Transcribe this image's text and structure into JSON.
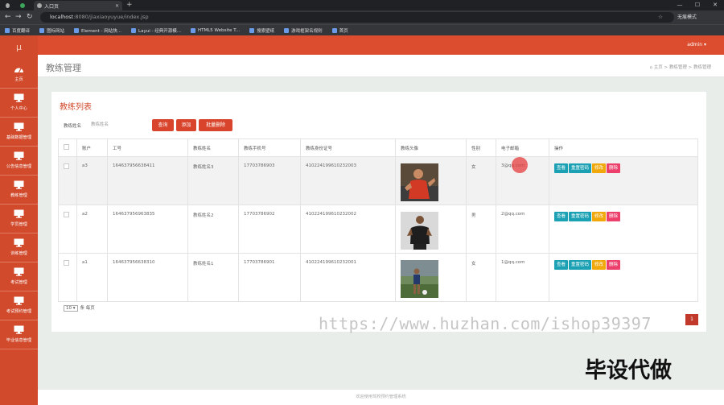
{
  "browser": {
    "tab_title": "入口页",
    "url_host": "localhost",
    "url_rest": ":8080/jiaxiaoyuyue/index.jsp",
    "profile": "无痕模式",
    "bookmarks": [
      "百度翻译",
      "图标网站",
      "Element - 网站快...",
      "Layui - 经典开源模...",
      "HTML5 Website T...",
      "搜索壁纸",
      "游戏框架名规则",
      "首页"
    ]
  },
  "app": {
    "logo": "μ",
    "admin": "admin ▾",
    "sidebar": [
      {
        "label": "主页"
      },
      {
        "label": "个人中心"
      },
      {
        "label": "基础数据管理"
      },
      {
        "label": "公告信息管理"
      },
      {
        "label": "教练管理"
      },
      {
        "label": "学员管理"
      },
      {
        "label": "训练管理"
      },
      {
        "label": "考试管理"
      },
      {
        "label": "考试预约管理"
      },
      {
        "label": "毕业信息管理"
      }
    ],
    "page_title": "教练管理",
    "breadcrumb": "⌂ 主页 > 教练管理 > 教练管理"
  },
  "panel": {
    "title": "教练列表",
    "search_label": "教练姓名",
    "search_placeholder": "教练姓名",
    "btn_query": "查询",
    "btn_add": "添加",
    "btn_batch_delete": "批量删除",
    "columns": [
      "",
      "账户",
      "工号",
      "教练姓名",
      "教练手机号",
      "教练身份证号",
      "教练头像",
      "性别",
      "电子邮箱",
      "操作"
    ],
    "rows": [
      {
        "account": "a3",
        "job_no": "164637956638411",
        "name": "教练姓名3",
        "phone": "17703786903",
        "id_card": "410224199610232003",
        "gender": "女",
        "email": "3@qq.com"
      },
      {
        "account": "a2",
        "job_no": "164637956963835",
        "name": "教练姓名2",
        "phone": "17703786902",
        "id_card": "410224199610232002",
        "gender": "男",
        "email": "2@qq.com"
      },
      {
        "account": "a1",
        "job_no": "164637956638310",
        "name": "教练姓名1",
        "phone": "17703786901",
        "id_card": "410224199610232001",
        "gender": "女",
        "email": "1@qq.com"
      }
    ],
    "ops": {
      "view": "查看",
      "reset": "重置密码",
      "edit": "修改",
      "delete": "删除"
    },
    "page_size": "10",
    "page_size_suffix": "条 每页",
    "current_page": "1"
  },
  "watermark": "https://www.huzhan.com/ishop39397",
  "watermark2": "毕设代做",
  "footer": "欢迎使用驾校预约管理系统",
  "colors": {
    "sidebar": "#d14a2b",
    "accent": "#dc4c2f",
    "view": "#1ba1b3",
    "edit": "#f1a80b",
    "delete": "#ec3f6b"
  }
}
